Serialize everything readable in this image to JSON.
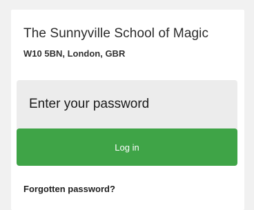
{
  "school": {
    "name": "The Sunnyville School of Magic",
    "address": "W10 5BN, London, GBR"
  },
  "login": {
    "password_placeholder": "Enter your password",
    "password_value": "",
    "button_label": "Log in",
    "forgot_label": "Forgotten password?"
  },
  "colors": {
    "accent": "#3fa447",
    "field_background": "#ececec",
    "page_background": "#f1f1f1"
  }
}
